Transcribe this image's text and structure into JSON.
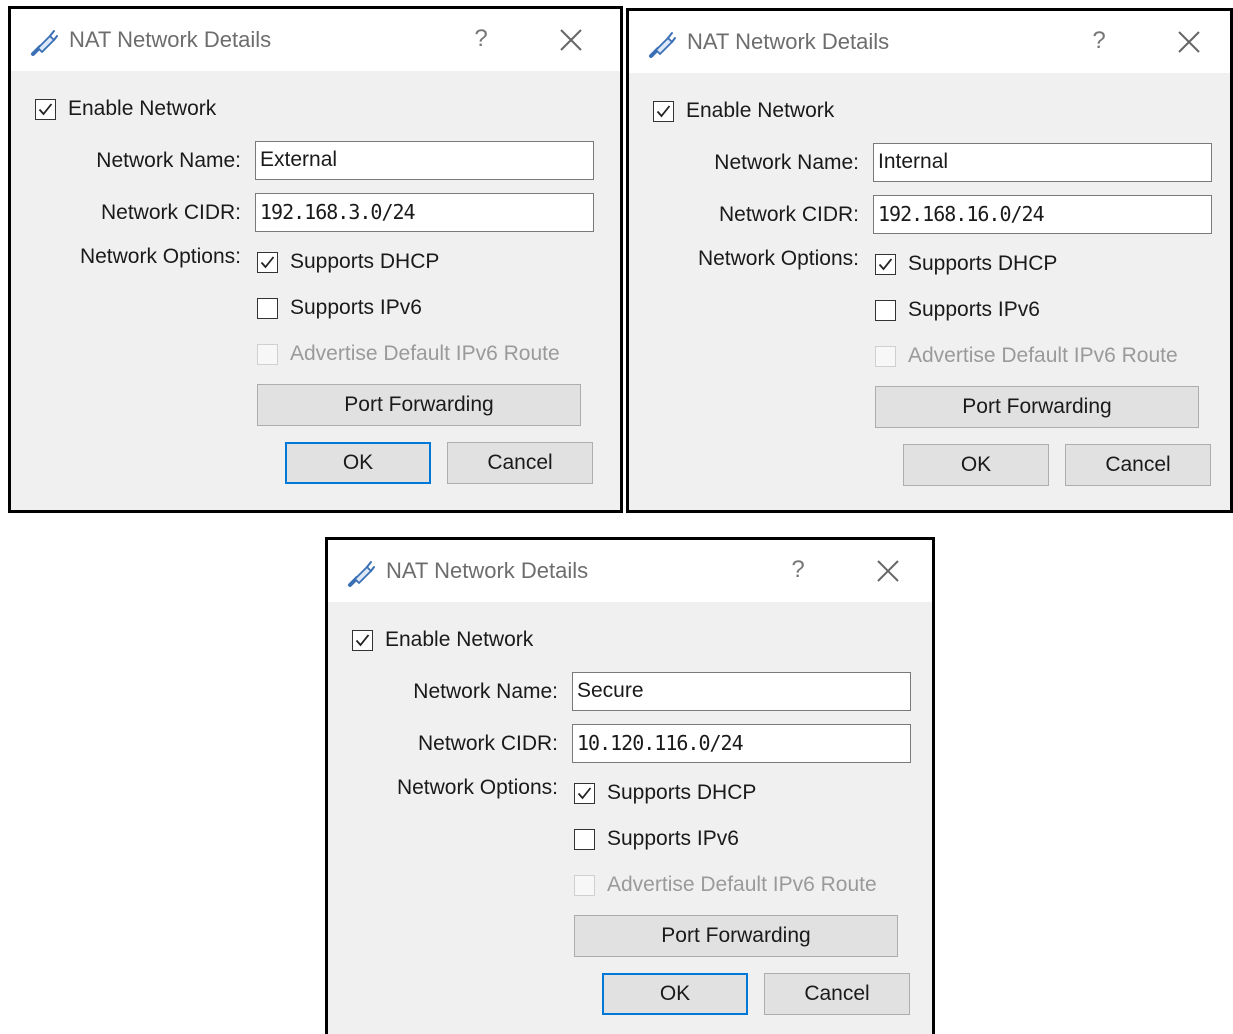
{
  "dialogs": [
    {
      "title": "NAT Network Details",
      "help_glyph": "?",
      "enable_network": {
        "label": "Enable Network",
        "checked": true
      },
      "network_name": {
        "label": "Network Name:",
        "value": "External"
      },
      "network_cidr": {
        "label": "Network CIDR:",
        "value": "192.168.3.0/24"
      },
      "network_options_label": "Network Options:",
      "supports_dhcp": {
        "label": "Supports DHCP",
        "checked": true
      },
      "supports_ipv6": {
        "label": "Supports IPv6",
        "checked": false
      },
      "advertise_route": {
        "label": "Advertise Default IPv6 Route",
        "checked": false,
        "disabled": true
      },
      "port_forwarding_label": "Port Forwarding",
      "ok_label": "OK",
      "cancel_label": "Cancel",
      "ok_is_default": true
    },
    {
      "title": "NAT Network Details",
      "help_glyph": "?",
      "enable_network": {
        "label": "Enable Network",
        "checked": true
      },
      "network_name": {
        "label": "Network Name:",
        "value": "Internal"
      },
      "network_cidr": {
        "label": "Network CIDR:",
        "value": "192.168.16.0/24"
      },
      "network_options_label": "Network Options:",
      "supports_dhcp": {
        "label": "Supports DHCP",
        "checked": true
      },
      "supports_ipv6": {
        "label": "Supports IPv6",
        "checked": false
      },
      "advertise_route": {
        "label": "Advertise Default IPv6 Route",
        "checked": false,
        "disabled": true
      },
      "port_forwarding_label": "Port Forwarding",
      "ok_label": "OK",
      "cancel_label": "Cancel",
      "ok_is_default": false
    },
    {
      "title": "NAT Network Details",
      "help_glyph": "?",
      "enable_network": {
        "label": "Enable Network",
        "checked": true
      },
      "network_name": {
        "label": "Network Name:",
        "value": "Secure"
      },
      "network_cidr": {
        "label": "Network CIDR:",
        "value": "10.120.116.0/24"
      },
      "network_options_label": "Network Options:",
      "supports_dhcp": {
        "label": "Supports DHCP",
        "checked": true
      },
      "supports_ipv6": {
        "label": "Supports IPv6",
        "checked": false
      },
      "advertise_route": {
        "label": "Advertise Default IPv6 Route",
        "checked": false,
        "disabled": true
      },
      "port_forwarding_label": "Port Forwarding",
      "ok_label": "OK",
      "cancel_label": "Cancel",
      "ok_is_default": true
    }
  ],
  "colors": {
    "dialog_bg": "#f0f0f0",
    "titlebar_bg": "#ffffff",
    "button_bg": "#e1e1e1",
    "default_button_border": "#0078d7",
    "disabled_text": "#9a9a9a"
  },
  "icons": {
    "app": "network-cable-icon",
    "help": "help-icon",
    "close": "close-icon",
    "check": "checkmark-icon"
  }
}
